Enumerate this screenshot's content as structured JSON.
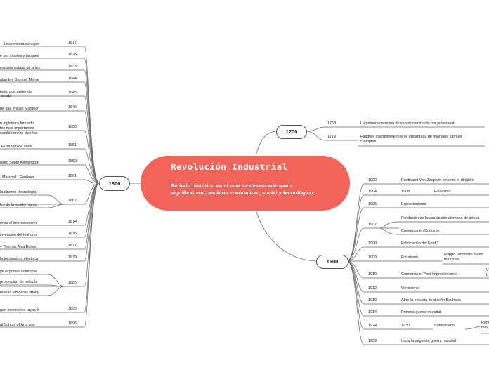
{
  "central": {
    "title": "Revolución Industrial",
    "subtitle": "Periodo histórico en el cual se desencadenaron significativos cambios económico , social y tecnológico"
  },
  "branches": {
    "b1800": {
      "label": "1800"
    },
    "b1700": {
      "label": "1700"
    },
    "b1900": {
      "label": "1900"
    }
  },
  "items_1800": [
    {
      "year": "1817",
      "text": "Locomotora de vapor"
    },
    {
      "year": "1826",
      "text": "e por charles y jacques"
    },
    {
      "year": "1833",
      "text": "escuela estatal de artes"
    },
    {
      "year": "1844",
      "text": "alambre Samuel Morse"
    },
    {
      "year": "1845",
      "text": "iento que pretende\n artista"
    },
    {
      "year": "1846",
      "text": "de gas Willian Murdoch"
    },
    {
      "year": "1850",
      "text": "n inglaterra fundado\ntos mas importantes\ncambio en los diseños"
    },
    {
      "year": "1851",
      "text": "\"El trabajo de unos"
    },
    {
      "year": "1852",
      "text": "useo South Kensington"
    },
    {
      "year": "1861",
      "text": ", Marshall , Faulkner"
    },
    {
      "year": "1867",
      "sub": [
        "la dinomo (tecnologia)",
        "les de la academia de"
      ]
    },
    {
      "year": "1874",
      "text": "enza el impresionismo"
    },
    {
      "year": "1876",
      "text": "invención del teléfono"
    },
    {
      "year": "1877",
      "text": "y Thomas Alva Edison"
    },
    {
      "year": "1879",
      "text": "la locomotora eléctrica"
    },
    {
      "year": "1885",
      "sub": [
        "ye el primer automóvil",
        "proyección de pelicula",
        "rea las lamparas tiffany"
      ]
    },
    {
      "year": "1895",
      "text": "gen invento los rayos X"
    },
    {
      "year": "1896",
      "text": "al School of Arts and"
    }
  ],
  "items_1700": [
    {
      "year": "1768",
      "text": "La primera maquina de vaporr construida por james watt"
    },
    {
      "year": "1779",
      "text": "Hiladora intermitente que se encargaba de hilar lana samuel\ncrompton"
    }
  ],
  "items_1900": [
    {
      "year": "1900",
      "text": "Ferdinand Von Zeepplin  invento el dirigible"
    },
    {
      "year": "1904",
      "text": "1908",
      "text2": "Fauvismo"
    },
    {
      "year": "1905",
      "text": "Expresionismo"
    },
    {
      "year": "1907",
      "sub": [
        "Fundación de la asociación alemana de artesa",
        "Comienza en Cubismo"
      ]
    },
    {
      "year": "1908",
      "text": "Fabricación del Ford T"
    },
    {
      "year": "1909",
      "text": "Futurismo",
      "text2": "Filippo Tommaso Marin\nfuturistas"
    },
    {
      "year": "1910",
      "text": "Comienza el Post-impresionismo",
      "text2": "V\nb"
    },
    {
      "year": "1912",
      "text": "Vorticismo"
    },
    {
      "year": "1919",
      "text": "Abre la escuela de diseño Bauhaus"
    },
    {
      "year": "1914",
      "text": "Primera guerra mundial"
    },
    {
      "year": "1924",
      "text": "1930",
      "text2": "Surrealismo",
      "text3": "Rem\nmov"
    },
    {
      "year": "1939",
      "text": "Inicia la segunda guerra mundial"
    }
  ]
}
